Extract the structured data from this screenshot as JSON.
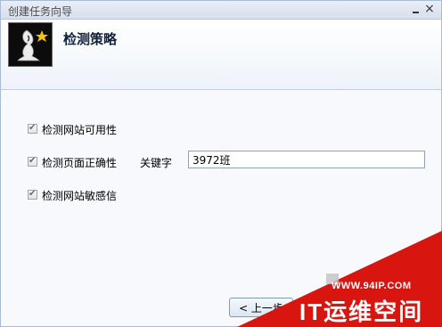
{
  "window": {
    "title": "创建任务向导",
    "close_glyph": "×"
  },
  "header": {
    "title": "检测策略",
    "logo_icon": "wizard-hat-logo"
  },
  "options": [
    {
      "label": "检测网站可用性",
      "checked": true
    },
    {
      "label": "检测页面正确性",
      "checked": true
    },
    {
      "label": "检测网站敏感信",
      "checked": true
    }
  ],
  "keyword": {
    "label": "关键字",
    "value": "3972班"
  },
  "footer": {
    "back_label": "< 上一步"
  },
  "watermark": {
    "url": "WWW.94IP.COM",
    "brand": "IT运维空间",
    "color": "#d8160f"
  }
}
